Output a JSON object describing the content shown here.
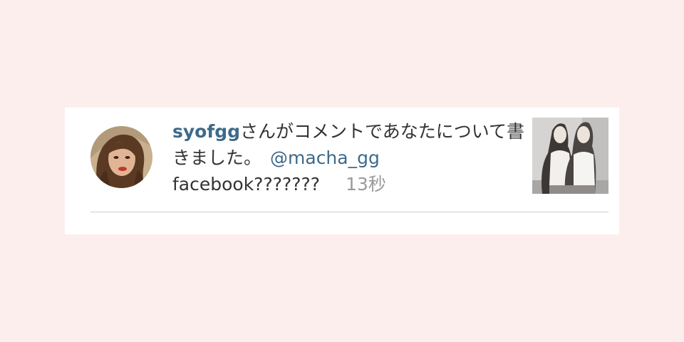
{
  "notification": {
    "username": "syofgg",
    "message": "さんがコメントであなたについて書きました。",
    "mention": "@macha_gg",
    "comment": "facebook???????",
    "time": "13秒"
  }
}
